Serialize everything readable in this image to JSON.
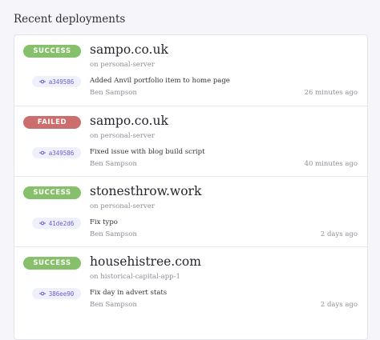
{
  "heading": "Recent deployments",
  "colors": {
    "success": "#86c06a",
    "failed": "#cc6e6e"
  },
  "deployments": [
    {
      "status": "SUCCESS",
      "status_kind": "success",
      "site": "sampo.co.uk",
      "server": "on personal-server",
      "commit_hash": "a349586",
      "commit_icon": "commit-icon",
      "message": "Added Anvil portfolio item to home page",
      "author": "Ben Sampson",
      "time": "26 minutes ago"
    },
    {
      "status": "FAILED",
      "status_kind": "failed",
      "site": "sampo.co.uk",
      "server": "on personal-server",
      "commit_hash": "a349586",
      "commit_icon": "commit-icon",
      "message": "Fixed issue with blog build script",
      "author": "Ben Sampson",
      "time": "40 minutes ago"
    },
    {
      "status": "SUCCESS",
      "status_kind": "success",
      "site": "stonesthrow.work",
      "server": "on personal-server",
      "commit_hash": "41de2d6",
      "commit_icon": "commit-icon",
      "message": "Fix typo",
      "author": "Ben Sampson",
      "time": "2 days ago"
    },
    {
      "status": "SUCCESS",
      "status_kind": "success",
      "site": "househistree.com",
      "server": "on historical-capital-app-1",
      "commit_hash": "386ee90",
      "commit_icon": "commit-icon",
      "message": "Fix day in advert stats",
      "author": "Ben Sampson",
      "time": "2 days ago"
    }
  ]
}
